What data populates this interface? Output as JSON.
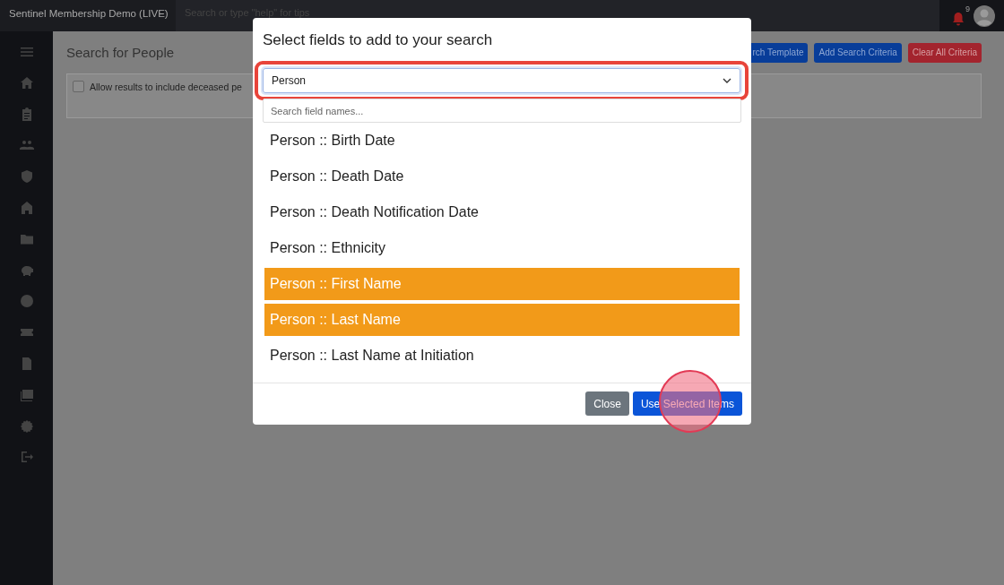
{
  "app": {
    "title": "Sentinel Membership Demo (LIVE)",
    "search_placeholder": "Search or type \"help\" for tips",
    "notification_count": "9"
  },
  "page": {
    "title": "Search for People",
    "buttons": [
      {
        "label": "rch Template",
        "kind": "primary"
      },
      {
        "label": "Add Search Criteria",
        "kind": "primary"
      },
      {
        "label": "Clear All Criteria",
        "kind": "danger"
      }
    ],
    "deceased_option": {
      "label": "Allow results to include deceased pe",
      "checked": false
    }
  },
  "modal": {
    "title": "Select fields to add to your search",
    "category_select": {
      "value": "Person"
    },
    "search": {
      "placeholder": "Search field names..."
    },
    "fields": [
      {
        "label": "Person :: Birth Date",
        "selected": false
      },
      {
        "label": "Person :: Death Date",
        "selected": false
      },
      {
        "label": "Person :: Death Notification Date",
        "selected": false
      },
      {
        "label": "Person :: Ethnicity",
        "selected": false
      },
      {
        "label": "Person :: First Name",
        "selected": true
      },
      {
        "label": "Person :: Last Name",
        "selected": true
      },
      {
        "label": "Person :: Last Name at Initiation",
        "selected": false
      }
    ],
    "buttons": [
      {
        "label": "Close",
        "kind": "secondary"
      },
      {
        "label": "Use Selected Items",
        "kind": "primary"
      }
    ]
  }
}
